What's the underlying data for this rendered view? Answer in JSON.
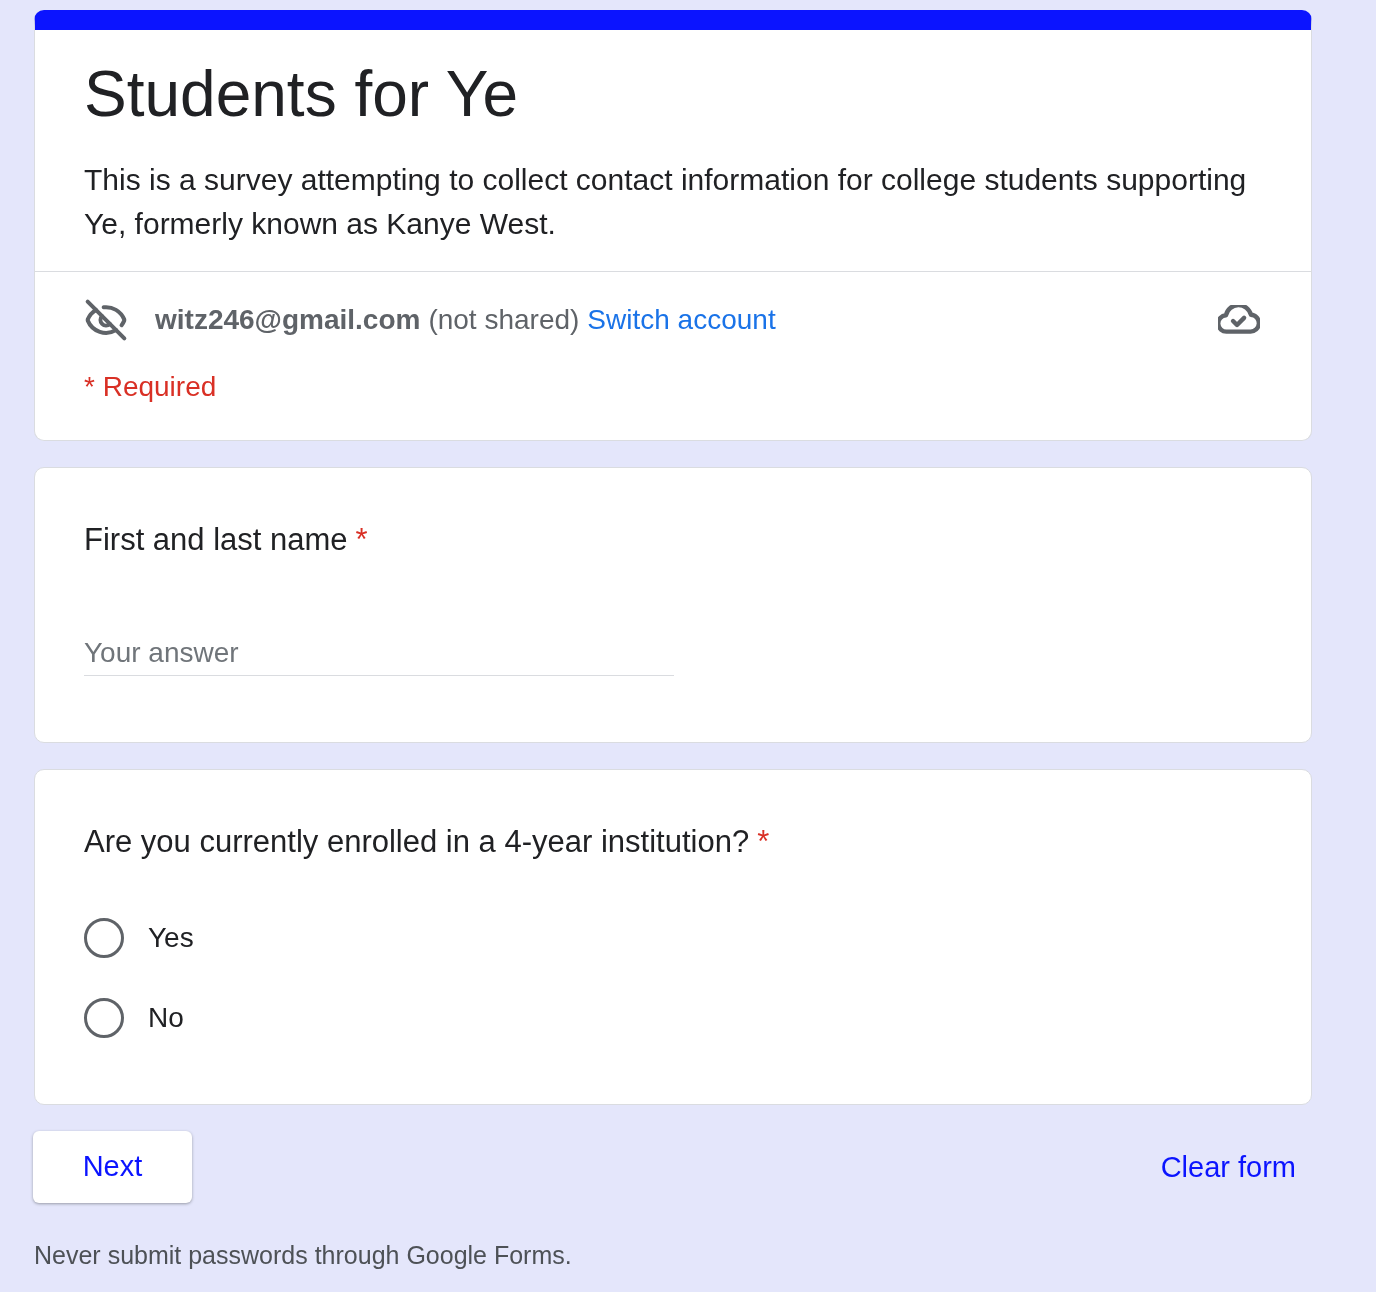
{
  "form": {
    "title": "Students for Ye",
    "description": "This is a survey attempting to collect contact information for college students supporting Ye, formerly known as Kanye West.",
    "account": {
      "email": "witz246@gmail.com",
      "note": "(not shared)",
      "switch_link": "Switch account"
    },
    "required_note": "* Required"
  },
  "questions": [
    {
      "kind": "short_answer",
      "title": "First and last name",
      "required_mark": "*",
      "placeholder": "Your answer"
    },
    {
      "kind": "radio",
      "title": "Are you currently enrolled in a 4-year institution?",
      "required_mark": "*",
      "options": [
        {
          "label": "Yes",
          "selected": false
        },
        {
          "label": "No",
          "selected": false
        }
      ]
    }
  ],
  "actions": {
    "next": "Next",
    "clear": "Clear form"
  },
  "footer": "Never submit passwords through Google Forms."
}
